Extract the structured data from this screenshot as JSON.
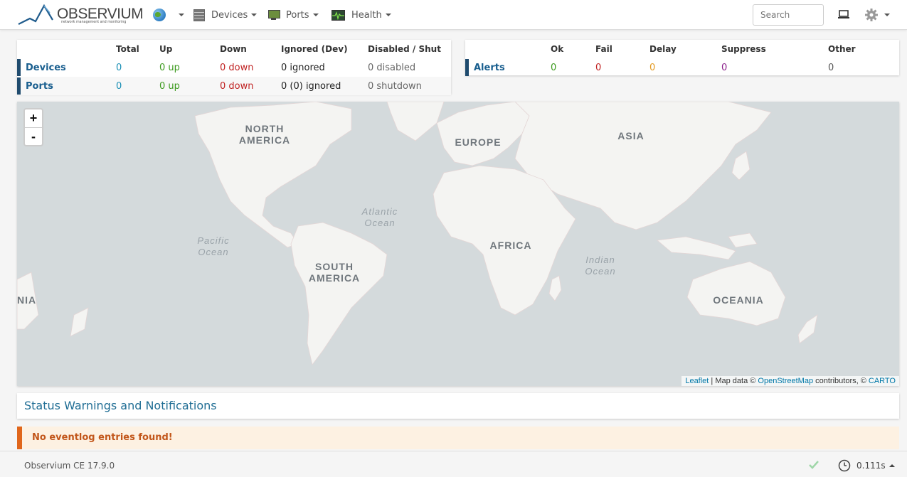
{
  "nav": {
    "logo_text": "OBSERVIUM",
    "logo_sub": "network management and monitoring",
    "devices_label": "Devices",
    "ports_label": "Ports",
    "health_label": "Health",
    "search_placeholder": "Search"
  },
  "summary": {
    "headers": [
      "Total",
      "Up",
      "Down",
      "Ignored (Dev)",
      "Disabled / Shut"
    ],
    "rows": [
      {
        "label": "Devices",
        "total": "0",
        "up": "0 up",
        "down": "0 down",
        "ignored": "0 ignored",
        "disabled": "0 disabled"
      },
      {
        "label": "Ports",
        "total": "0",
        "up": "0 up",
        "down": "0 down",
        "ignored": "0 (0) ignored",
        "disabled": "0 shutdown"
      }
    ]
  },
  "alerts": {
    "headers": [
      "Ok",
      "Fail",
      "Delay",
      "Suppress",
      "Other"
    ],
    "label": "Alerts",
    "ok": "0",
    "fail": "0",
    "delay": "0",
    "suppress": "0",
    "other": "0"
  },
  "map": {
    "zoom_in": "+",
    "zoom_out": "-",
    "labels": {
      "north_america": "NORTH\nAMERICA",
      "europe": "EUROPE",
      "asia": "ASIA",
      "atlantic": "Atlantic\nOcean",
      "pacific": "Pacific\nOcean",
      "africa": "AFRICA",
      "indian": "Indian\nOcean",
      "south_america": "SOUTH\nAMERICA",
      "oceania": "OCEANIA",
      "nia": "NIA"
    },
    "attribution": {
      "leaflet": "Leaflet",
      "map_data": " | Map data © ",
      "osm": "OpenStreetMap",
      "contrib": " contributors, © ",
      "carto": "CARTO"
    }
  },
  "status": {
    "title": "Status Warnings and Notifications",
    "eventlog_message": "No eventlog entries found!"
  },
  "footer": {
    "version": "Observium CE 17.9.0",
    "time": "0.111s"
  }
}
